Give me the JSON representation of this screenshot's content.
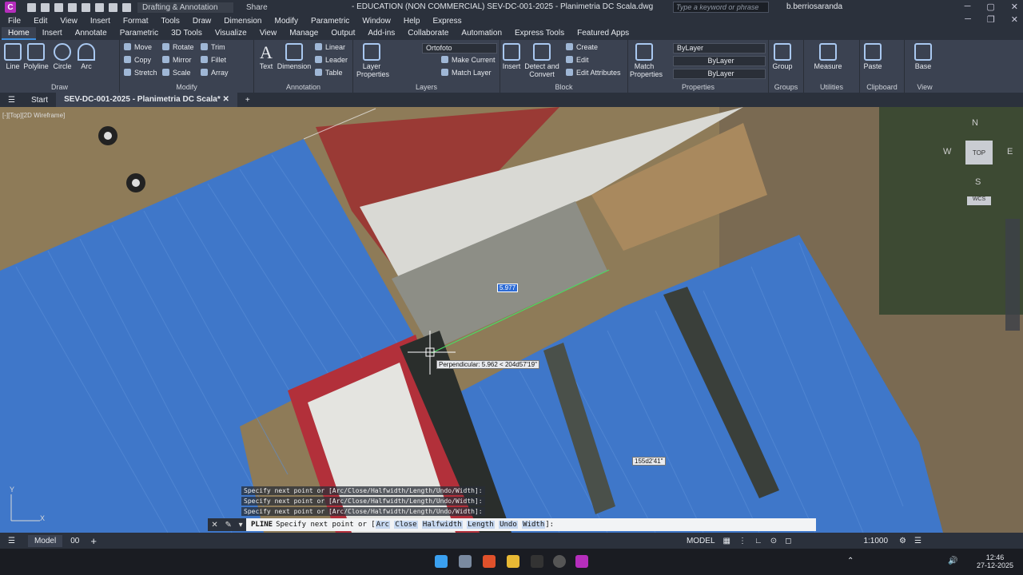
{
  "app": {
    "icon_letter": "C",
    "workspace": "Drafting & Annotation",
    "share": "Share",
    "title": "- EDUCATION (NON COMMERCIAL)   SEV-DC-001-2025 - Planimetria DC Scala.dwg",
    "search_placeholder": "Type a keyword or phrase",
    "user": "b.berriosaranda"
  },
  "menu": [
    "File",
    "Edit",
    "View",
    "Insert",
    "Format",
    "Tools",
    "Draw",
    "Dimension",
    "Modify",
    "Parametric",
    "Window",
    "Help",
    "Express"
  ],
  "ribbon_tabs": [
    "Home",
    "Insert",
    "Annotate",
    "Parametric",
    "3D Tools",
    "Visualize",
    "View",
    "Manage",
    "Output",
    "Add-ins",
    "Collaborate",
    "Automation",
    "Express Tools",
    "Featured Apps"
  ],
  "ribbon": {
    "draw": {
      "title": "Draw",
      "line": "Line",
      "polyline": "Polyline",
      "circle": "Circle",
      "arc": "Arc"
    },
    "modify": {
      "title": "Modify",
      "move": "Move",
      "rotate": "Rotate",
      "trim": "Trim",
      "copy": "Copy",
      "mirror": "Mirror",
      "fillet": "Fillet",
      "stretch": "Stretch",
      "scale": "Scale",
      "array": "Array"
    },
    "annotation": {
      "title": "Annotation",
      "text": "Text",
      "dimension": "Dimension",
      "linear": "Linear",
      "leader": "Leader",
      "table": "Table"
    },
    "layers": {
      "title": "Layers",
      "layer_properties": "Layer Properties",
      "current_layer": "Ortofoto",
      "make_current": "Make Current",
      "match_layer": "Match Layer"
    },
    "block": {
      "title": "Block",
      "insert": "Insert",
      "detect": "Detect and Convert",
      "create": "Create",
      "edit": "Edit",
      "edit_attributes": "Edit Attributes"
    },
    "properties": {
      "title": "Properties",
      "match": "Match Properties",
      "color": "ByLayer",
      "linetype": "ByLayer",
      "lineweight": "ByLayer"
    },
    "groups": {
      "title": "Groups",
      "group": "Group"
    },
    "utilities": {
      "title": "Utilities",
      "measure": "Measure"
    },
    "clipboard": {
      "title": "Clipboard",
      "paste": "Paste"
    },
    "view": {
      "title": "View",
      "base": "Base"
    }
  },
  "doc_tabs": {
    "start": "Start",
    "active": "SEV-DC-001-2025 - Planimetria DC Scala*"
  },
  "canvas": {
    "view_label": "[-][Top][2D Wireframe]",
    "dynamic_input": "5.977",
    "tracking_tooltip": "Perpendicular: 5.962 < 204d57'19\"",
    "angle_tooltip": "155d2'41\"",
    "viewcube": {
      "n": "N",
      "s": "S",
      "e": "E",
      "w": "W",
      "top": "TOP",
      "wcs": "WCS"
    },
    "ucs": {
      "x": "X",
      "y": "Y"
    }
  },
  "command": {
    "history": [
      "Specify next point or [Arc/Close/Halfwidth/Length/Undo/Width]:",
      "Specify next point or [Arc/Close/Halfwidth/Length/Undo/Width]:",
      "Specify next point or [Arc/Close/Halfwidth/Length/Undo/Width]:"
    ],
    "prompt_cmd": "PLINE",
    "prompt_text": "Specify next point or [",
    "options": [
      "Arc",
      "Close",
      "Halfwidth",
      "Length",
      "Undo",
      "Width"
    ],
    "prompt_end": "]:"
  },
  "status": {
    "model_tab": "Model",
    "layout_tab": "00",
    "model": "MODEL",
    "scale": "1:1000"
  },
  "taskbar": {
    "time": "12:46",
    "date": "27-12-2025"
  },
  "colors": {
    "accent": "#3d8fe0",
    "roof_blue": "#3f77c9",
    "roof_red": "#9a3a35",
    "autocad_purple": "#b52ebc"
  }
}
